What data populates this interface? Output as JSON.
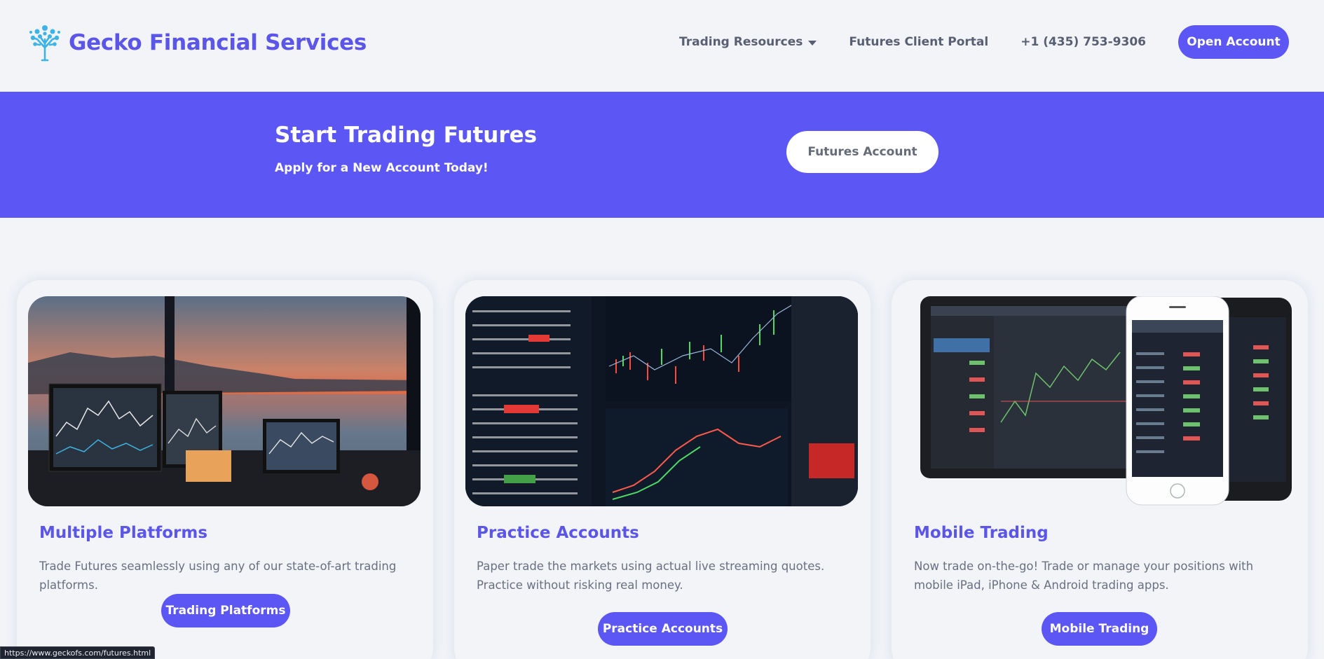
{
  "header": {
    "brand_name": "Gecko Financial Services",
    "logo_icon": "tree-icon",
    "nav": {
      "trading_resources": "Trading Resources",
      "client_portal": "Futures Client Portal",
      "phone": "+1 (435) 753-9306",
      "open_account": "Open Account"
    }
  },
  "banner": {
    "title": "Start Trading Futures",
    "subtitle": "Apply for a New Account Today!",
    "button": "Futures Account"
  },
  "cards": [
    {
      "title": "Multiple Platforms",
      "text": "Trade Futures seamlessly using any of our state-of-art trading platforms.",
      "button": "Trading Platforms"
    },
    {
      "title": "Practice Accounts",
      "text": "Paper trade the markets using actual live streaming quotes. Practice without risking real money.",
      "button": "Practice Accounts"
    },
    {
      "title": "Mobile Trading",
      "text": "Now trade on-the-go! Trade or manage your positions with mobile iPad, iPhone & Android trading apps.",
      "button": "Mobile Trading"
    }
  ],
  "status_bar": {
    "url": "https://www.geckofs.com/futures.html"
  },
  "colors": {
    "accent": "#5b56f4",
    "background": "#f2f4f8",
    "brand_text": "#5b56e8"
  }
}
